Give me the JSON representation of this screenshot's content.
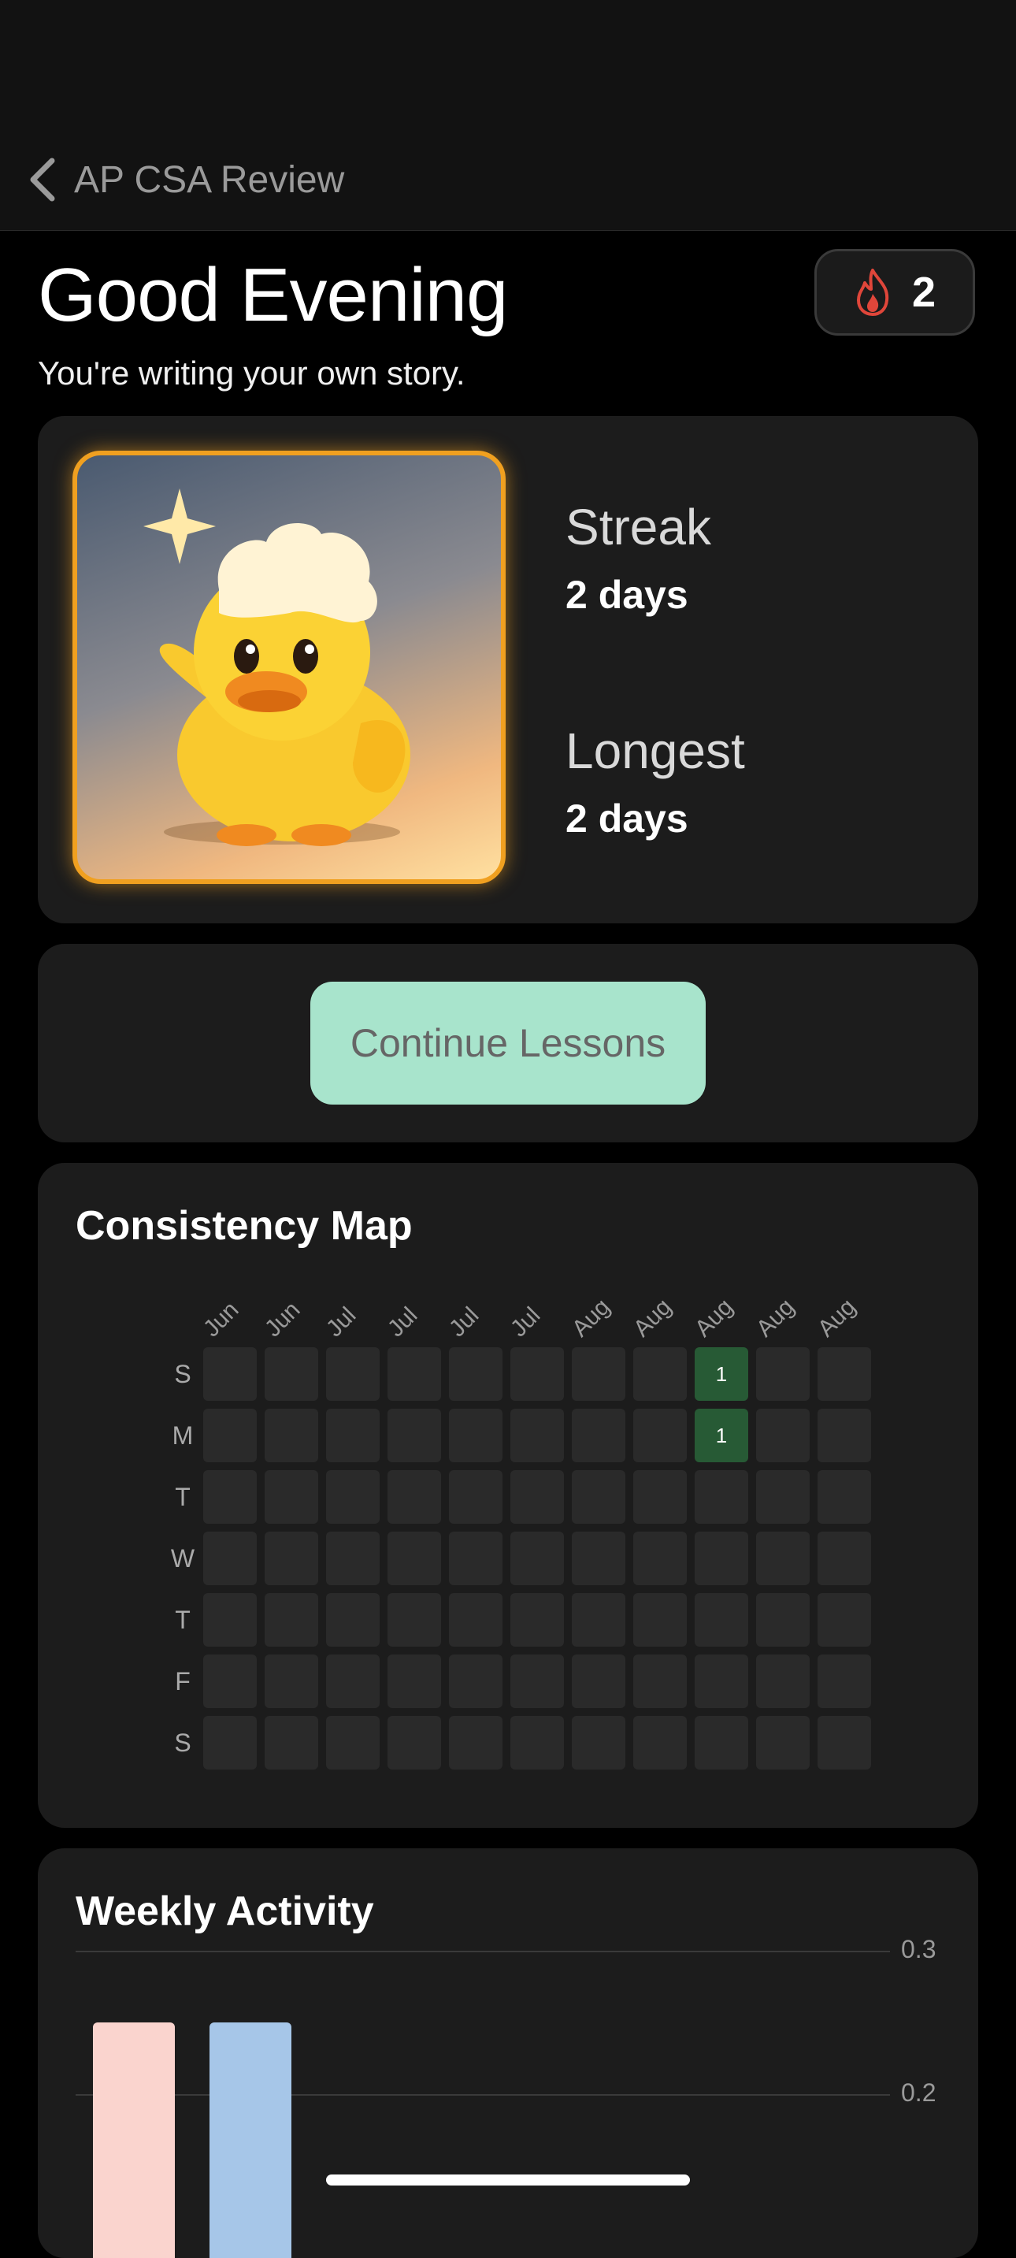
{
  "nav": {
    "back_label": "AP CSA Review"
  },
  "header": {
    "greeting": "Good Evening",
    "subtitle": "You're writing your own story.",
    "streak_count": "2"
  },
  "streak_card": {
    "streak_label": "Streak",
    "streak_value": "2 days",
    "longest_label": "Longest",
    "longest_value": "2 days"
  },
  "continue_button": "Continue Lessons",
  "consistency": {
    "title": "Consistency Map",
    "months": [
      "Jun",
      "Jun",
      "Jul",
      "Jul",
      "Jul",
      "Jul",
      "Aug",
      "Aug",
      "Aug",
      "Aug",
      "Aug"
    ],
    "days": [
      "S",
      "M",
      "T",
      "W",
      "T",
      "F",
      "S"
    ],
    "active": [
      {
        "row": 0,
        "col": 8,
        "value": "1"
      },
      {
        "row": 1,
        "col": 8,
        "value": "1"
      }
    ]
  },
  "weekly": {
    "title": "Weekly Activity",
    "ticks": [
      "0.3",
      "0.2"
    ]
  },
  "chart_data": {
    "type": "bar",
    "title": "Weekly Activity",
    "series": [
      {
        "color": "#fad4ce",
        "values": [
          0.25
        ]
      },
      {
        "color": "#a6c6e8",
        "values": [
          0.25
        ]
      }
    ],
    "yticks": [
      0.3,
      0.2
    ]
  },
  "colors": {
    "accent_mint": "#a8e4cc",
    "streak_flame": "#e0463a",
    "active_cell": "#275a35"
  }
}
